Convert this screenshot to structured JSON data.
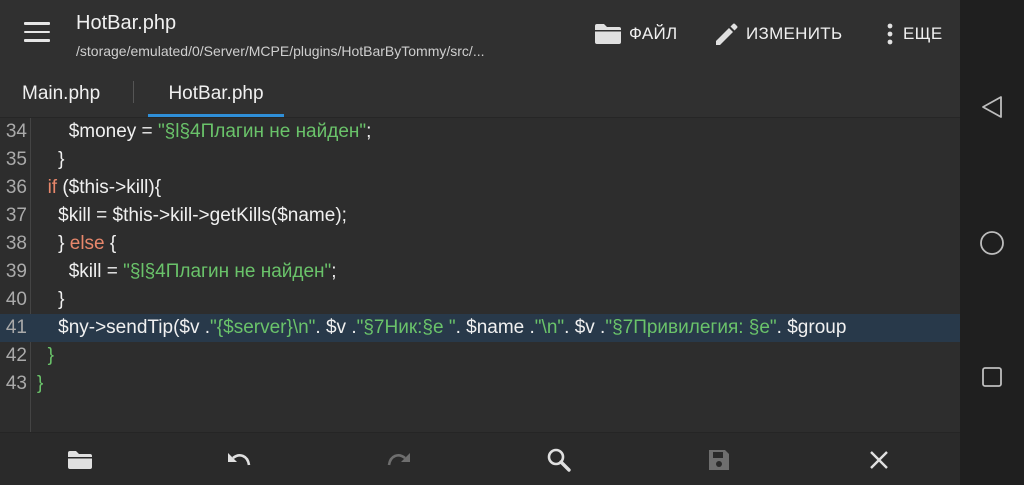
{
  "header": {
    "title": "HotBar.php",
    "path": "/storage/emulated/0/Server/MCPE/plugins/HotBarByTommy/src/..."
  },
  "actions": {
    "file_label": "ФАЙЛ",
    "edit_label": "ИЗМЕНИТЬ",
    "more_label": "ЕЩЕ"
  },
  "tabs": [
    {
      "label": "Main.php",
      "active": false
    },
    {
      "label": "HotBar.php",
      "active": true
    }
  ],
  "colors": {
    "accent": "#2f8fd8",
    "string": "#6ac36a",
    "keyword": "#e8876b",
    "highlight_line": "#28394a"
  },
  "code": {
    "highlighted_line": 41,
    "lines": [
      {
        "num": "34",
        "indent": "      ",
        "parts": [
          {
            "t": "$money = ",
            "c": ""
          },
          {
            "t": "\"§l§4Плагин не найден\"",
            "c": "str"
          },
          {
            "t": ";",
            "c": ""
          }
        ]
      },
      {
        "num": "35",
        "indent": "    ",
        "parts": [
          {
            "t": "}",
            "c": ""
          }
        ]
      },
      {
        "num": "36",
        "indent": "  ",
        "parts": [
          {
            "t": "if",
            "c": "kw"
          },
          {
            "t": " ($this->kill){",
            "c": ""
          }
        ]
      },
      {
        "num": "37",
        "indent": "    ",
        "parts": [
          {
            "t": "$kill = $this->kill->getKills($name);",
            "c": ""
          }
        ]
      },
      {
        "num": "38",
        "indent": "    ",
        "parts": [
          {
            "t": "} ",
            "c": ""
          },
          {
            "t": "else",
            "c": "kw"
          },
          {
            "t": " {",
            "c": ""
          }
        ]
      },
      {
        "num": "39",
        "indent": "      ",
        "parts": [
          {
            "t": "$kill = ",
            "c": ""
          },
          {
            "t": "\"§l§4Плагин не найден\"",
            "c": "str"
          },
          {
            "t": ";",
            "c": ""
          }
        ]
      },
      {
        "num": "40",
        "indent": "    ",
        "parts": [
          {
            "t": "}",
            "c": ""
          }
        ]
      },
      {
        "num": "41",
        "indent": "    ",
        "parts": [
          {
            "t": "$ny->sendTip($v .",
            "c": ""
          },
          {
            "t": "\"{$server}\\n\"",
            "c": "str"
          },
          {
            "t": ". $v .",
            "c": ""
          },
          {
            "t": "\"§7Ник:§e \"",
            "c": "str"
          },
          {
            "t": ". $name .",
            "c": ""
          },
          {
            "t": "\"\\n\"",
            "c": "str"
          },
          {
            "t": ". $v .",
            "c": ""
          },
          {
            "t": "\"§7Привилегия: §e\"",
            "c": "str"
          },
          {
            "t": ". $group",
            "c": ""
          }
        ]
      },
      {
        "num": "42",
        "indent": "  ",
        "parts": [
          {
            "t": "}",
            "c": "br"
          }
        ]
      },
      {
        "num": "43",
        "indent": "",
        "parts": [
          {
            "t": "}",
            "c": "br"
          }
        ]
      }
    ]
  },
  "bottom_toolbar": [
    {
      "icon": "folder-icon",
      "enabled": true
    },
    {
      "icon": "undo-icon",
      "enabled": true
    },
    {
      "icon": "redo-icon",
      "enabled": false
    },
    {
      "icon": "search-icon",
      "enabled": true
    },
    {
      "icon": "save-icon",
      "enabled": false
    },
    {
      "icon": "close-icon",
      "enabled": true
    }
  ],
  "system_nav": [
    {
      "icon": "back-icon"
    },
    {
      "icon": "home-icon"
    },
    {
      "icon": "recents-icon"
    }
  ]
}
